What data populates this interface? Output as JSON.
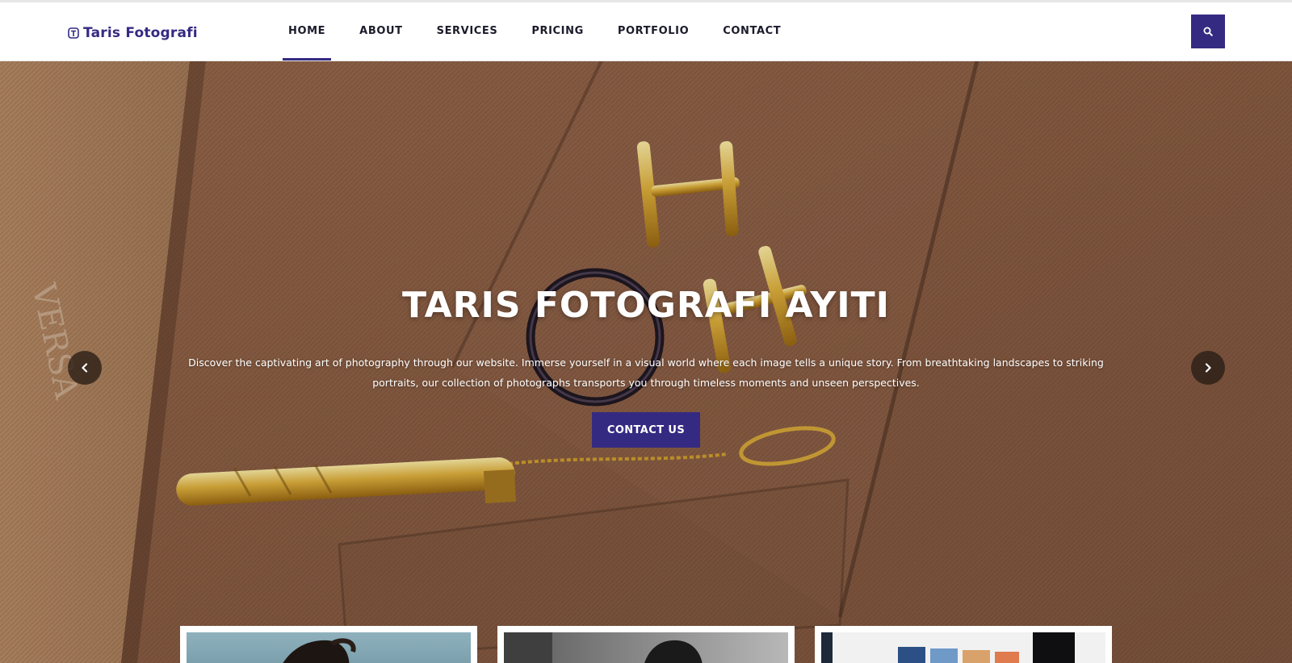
{
  "brand": {
    "name": "Taris Fotografi",
    "icon": "logo-icon"
  },
  "nav": {
    "items": [
      {
        "label": "HOME",
        "active": true
      },
      {
        "label": "ABOUT",
        "active": false
      },
      {
        "label": "SERVICES",
        "active": false
      },
      {
        "label": "PRICING",
        "active": false
      },
      {
        "label": "PORTFOLIO",
        "active": false
      },
      {
        "label": "CONTACT",
        "active": false
      }
    ],
    "search_icon": "search-icon"
  },
  "hero": {
    "title": "TARIS FOTOGRAFI AYITI",
    "description": "Discover the captivating art of photography through our website. Immerse yourself in a visual world where each image tells a unique story. From breathtaking landscapes to striking portraits, our collection of photographs transports you through timeless moments and unseen perspectives.",
    "cta_label": "CONTACT US",
    "prev_icon": "chevron-left-icon",
    "next_icon": "chevron-right-icon"
  },
  "cards": [
    {
      "name": "card-portrait-1"
    },
    {
      "name": "card-portrait-2"
    },
    {
      "name": "card-gallery-3"
    }
  ],
  "colors": {
    "accent": "#352a82",
    "nav_text": "#1b1b2b",
    "hero_bg": "#8c6146",
    "white": "#ffffff"
  }
}
